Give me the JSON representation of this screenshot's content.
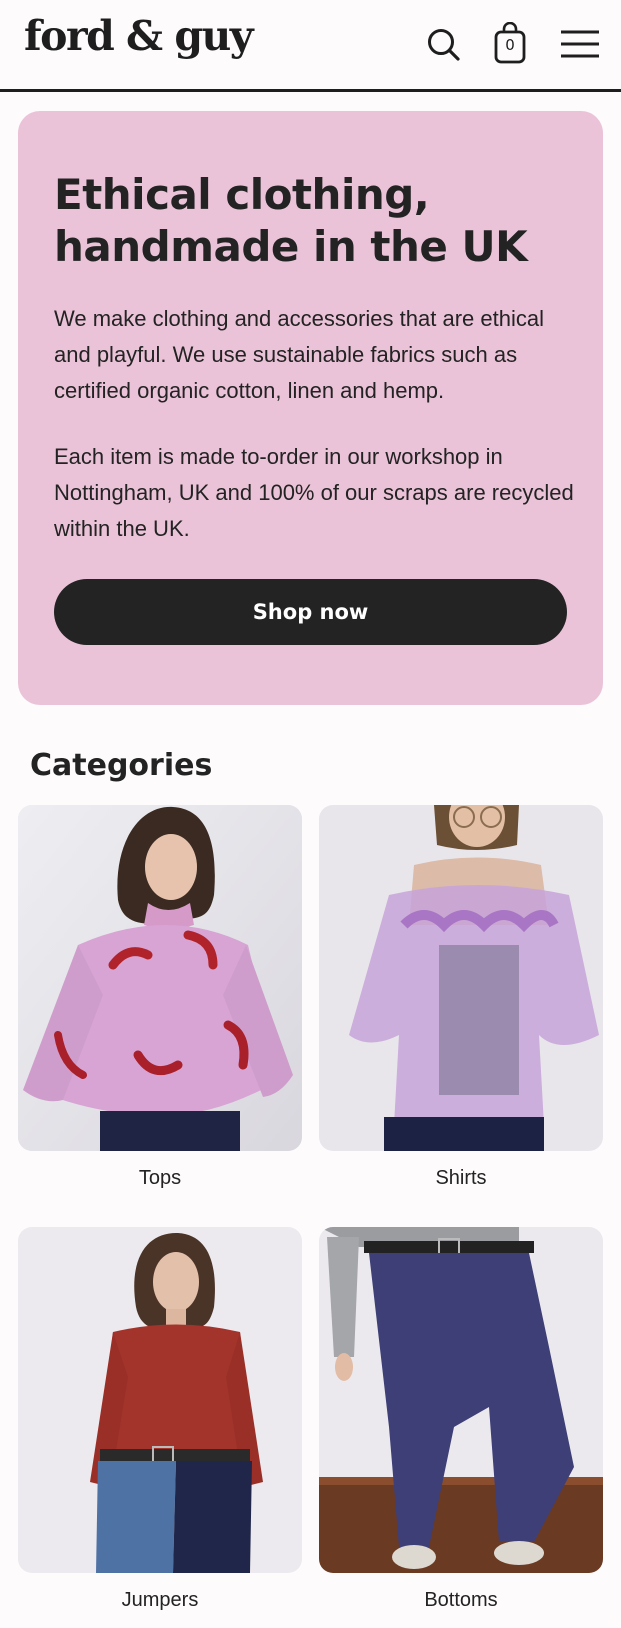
{
  "header": {
    "logo": "ford & guy",
    "cart_count": "0",
    "icons": [
      "search-icon",
      "shopping-bag-icon",
      "hamburger-menu-icon"
    ]
  },
  "hero": {
    "title": "Ethical clothing, handmade in the UK",
    "paragraph_1": "We make clothing and accessories that are ethical and playful. We use sustainable fabrics such as certified organic cotton, linen and hemp.",
    "paragraph_2": "Each item is made to-order in our workshop in Nottingham, UK and 100% of our scraps are recycled within the UK.",
    "cta_label": "Shop now",
    "background_color": "#ebc3d8",
    "button_color": "#232323"
  },
  "categories": {
    "title": "Categories",
    "items": [
      {
        "label": "Tops"
      },
      {
        "label": "Shirts"
      },
      {
        "label": "Jumpers"
      },
      {
        "label": "Bottoms"
      }
    ]
  }
}
